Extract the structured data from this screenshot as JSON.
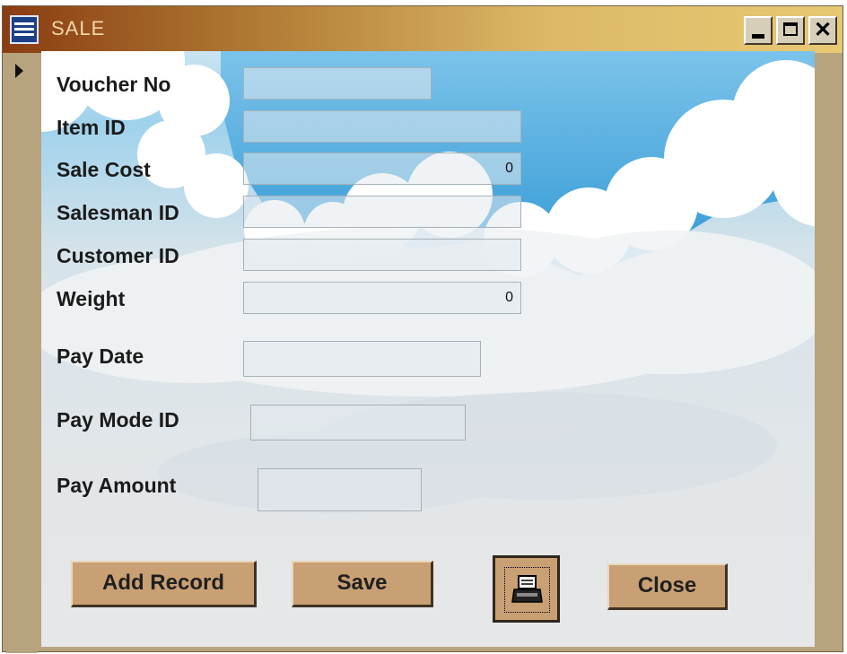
{
  "window": {
    "title": "SALE"
  },
  "form": {
    "fields": [
      {
        "label": "Voucher No",
        "value": ""
      },
      {
        "label": "Item ID",
        "value": ""
      },
      {
        "label": "Sale Cost",
        "value": "0"
      },
      {
        "label": "Salesman ID",
        "value": ""
      },
      {
        "label": "Customer ID",
        "value": ""
      },
      {
        "label": "Weight",
        "value": "0"
      },
      {
        "label": "Pay Date",
        "value": ""
      },
      {
        "label": "Pay Mode ID",
        "value": ""
      },
      {
        "label": "Pay Amount",
        "value": ""
      }
    ]
  },
  "buttons": {
    "add_record": "Add Record",
    "save": "Save",
    "print_icon": "printer-icon",
    "close": "Close"
  },
  "colors": {
    "title_bar": "#b07a34",
    "window_frame": "#b8a37f",
    "button_face": "#c9a073",
    "sky_blue": "#4aa9dc"
  }
}
